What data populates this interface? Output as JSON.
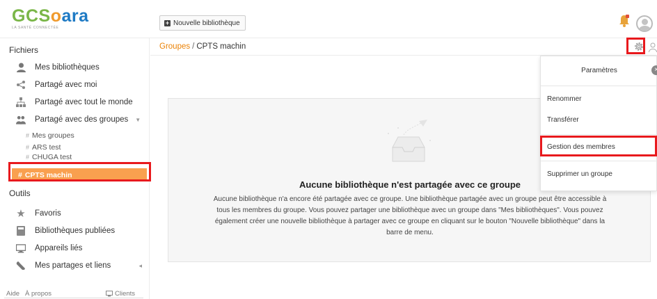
{
  "logo": {
    "name": "GCSoara",
    "tagline": "LA SANTÉ CONNECTÉE"
  },
  "toolbar": {
    "new_library": "Nouvelle bibliothèque"
  },
  "sidebar": {
    "files_title": "Fichiers",
    "items": [
      {
        "label": "Mes bibliothèques",
        "icon": "user-icon"
      },
      {
        "label": "Partagé avec moi",
        "icon": "share-icon"
      },
      {
        "label": "Partagé avec tout le monde",
        "icon": "org-chart-icon"
      },
      {
        "label": "Partagé avec des groupes",
        "icon": "group-icon"
      }
    ],
    "group_items": [
      "Mes groupes",
      "ARS test",
      "CHUGA test"
    ],
    "active_group": "CPTS machin",
    "tools_title": "Outils",
    "tools": [
      {
        "label": "Favoris",
        "icon": "star-icon"
      },
      {
        "label": "Bibliothèques publiées",
        "icon": "book-icon"
      },
      {
        "label": "Appareils liés",
        "icon": "monitor-icon"
      },
      {
        "label": "Mes partages et liens",
        "icon": "wrench-icon"
      }
    ],
    "footer": {
      "help": "Aide",
      "about": "À propos",
      "clients": "Clients"
    }
  },
  "breadcrumb": {
    "root": "Groupes",
    "separator": "/",
    "current": "CPTS machin"
  },
  "empty_state": {
    "title": "Aucune bibliothèque n'est partagée avec ce groupe",
    "description": "Aucune bibliothèque n'a encore été partagée avec ce groupe. Une bibliothèque partagée avec un groupe peut être accessible à tous les membres du groupe. Vous pouvez partager une bibliothèque avec un groupe dans \"Mes bibliothèques\". Vous pouvez également créer une nouvelle bibliothèque à partager avec ce groupe en cliquant sur le bouton \"Nouvelle bibliothèque\" dans la barre de menu."
  },
  "dropdown": {
    "title": "Paramètres",
    "items": [
      "Renommer",
      "Transférer",
      "Gestion des membres",
      "Supprimer un groupe"
    ]
  },
  "colors": {
    "accent": "#eb8205",
    "active_bg": "#f9a04f",
    "highlight_box": "#e8191d"
  }
}
